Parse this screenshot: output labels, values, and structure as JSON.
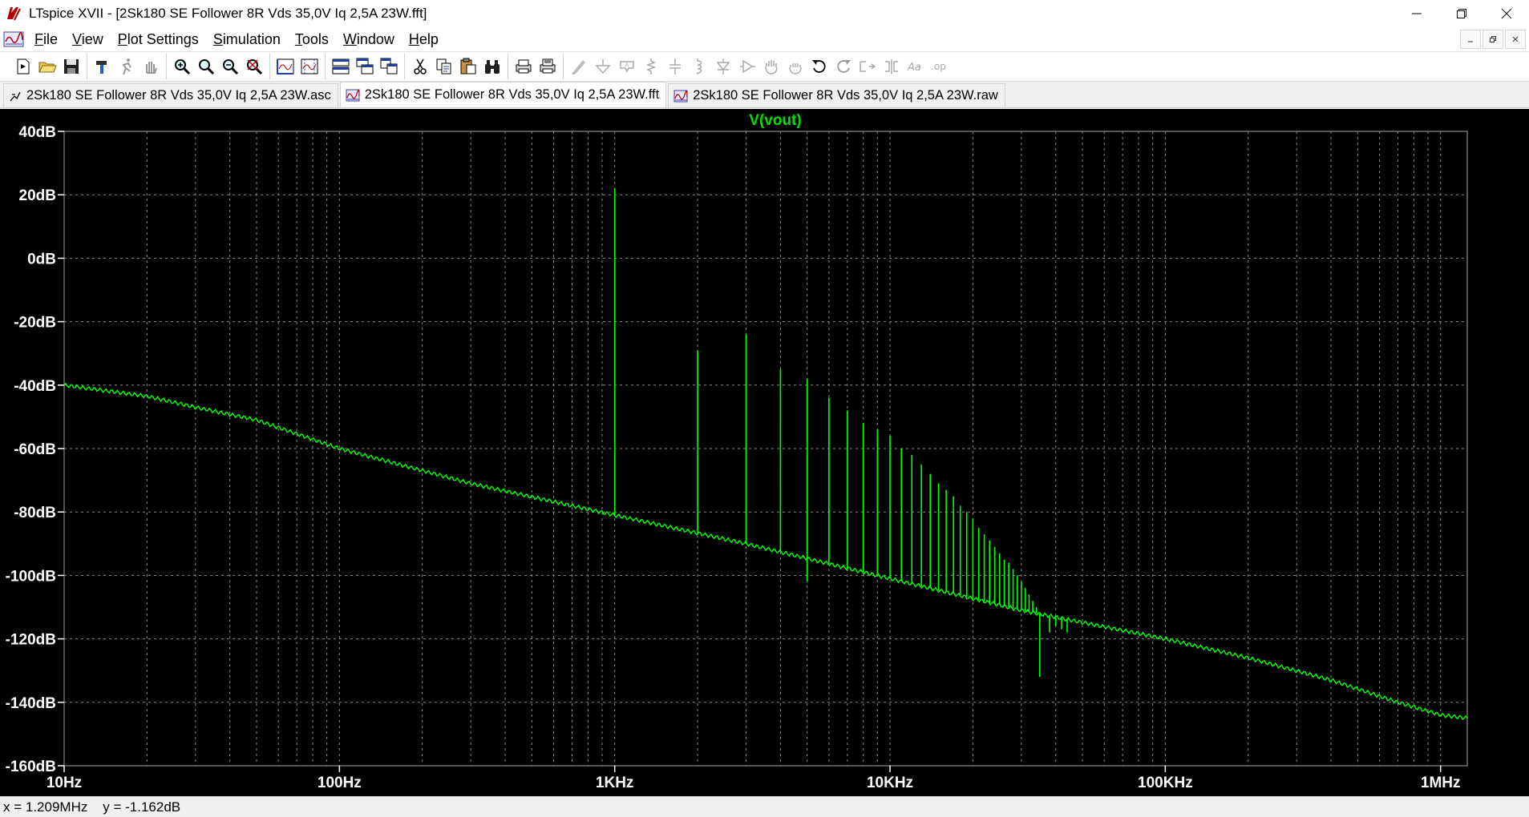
{
  "window": {
    "title": "LTspice XVII - [2Sk180 SE Follower 8R Vds 35,0V Iq 2,5A 23W.fft]"
  },
  "menu": {
    "items": [
      {
        "id": "file",
        "underline": "F",
        "rest": "ile"
      },
      {
        "id": "view",
        "underline": "V",
        "rest": "iew"
      },
      {
        "id": "plot-settings",
        "underline": "P",
        "rest": "lot Settings"
      },
      {
        "id": "simulation",
        "underline": "S",
        "rest": "imulation"
      },
      {
        "id": "tools",
        "underline": "T",
        "rest": "ools"
      },
      {
        "id": "window",
        "underline": "W",
        "rest": "indow"
      },
      {
        "id": "help",
        "underline": "H",
        "rest": "elp"
      }
    ]
  },
  "tabs": [
    {
      "label": "2Sk180 SE Follower 8R Vds 35,0V Iq 2,5A 23W.asc",
      "icon": "schematic-icon",
      "active": false
    },
    {
      "label": "2Sk180 SE Follower 8R Vds 35,0V Iq 2,5A 23W.fft",
      "icon": "waveform-icon",
      "active": true
    },
    {
      "label": "2Sk180 SE Follower 8R Vds 35,0V Iq 2,5A 23W.raw",
      "icon": "waveform-icon",
      "active": false
    }
  ],
  "status": {
    "x_readout": "x = 1.209MHz",
    "y_readout": "y = -1.162dB"
  },
  "colors": {
    "trace": "#00ff00",
    "title": "#00e000",
    "grid": "#8a8a8a",
    "background": "#000000",
    "axis_text": "#ffffff"
  },
  "chart_data": {
    "type": "line",
    "title": "V(vout)",
    "x_scale": "log",
    "x_range": [
      10,
      1250000
    ],
    "y_range": [
      -160,
      40
    ],
    "x_ticks": [
      {
        "value": 10,
        "label": "10Hz"
      },
      {
        "value": 100,
        "label": "100Hz"
      },
      {
        "value": 1000,
        "label": "1KHz"
      },
      {
        "value": 10000,
        "label": "10KHz"
      },
      {
        "value": 100000,
        "label": "100KHz"
      },
      {
        "value": 1000000,
        "label": "1MHz"
      }
    ],
    "y_ticks": [
      {
        "value": 40,
        "label": "40dB"
      },
      {
        "value": 20,
        "label": "20dB"
      },
      {
        "value": 0,
        "label": "0dB"
      },
      {
        "value": -20,
        "label": "-20dB"
      },
      {
        "value": -40,
        "label": "-40dB"
      },
      {
        "value": -60,
        "label": "-60dB"
      },
      {
        "value": -80,
        "label": "-80dB"
      },
      {
        "value": -100,
        "label": "-100dB"
      },
      {
        "value": -120,
        "label": "-120dB"
      },
      {
        "value": -140,
        "label": "-140dB"
      },
      {
        "value": -160,
        "label": "-160dB"
      }
    ],
    "grid": true,
    "series": [
      {
        "name": "V(vout)",
        "noise_floor": [
          [
            10,
            -40
          ],
          [
            20,
            -43.5
          ],
          [
            30,
            -47
          ],
          [
            50,
            -51
          ],
          [
            100,
            -60
          ],
          [
            300,
            -71
          ],
          [
            1000,
            -81
          ],
          [
            3000,
            -90
          ],
          [
            10000,
            -101
          ],
          [
            30000,
            -111
          ],
          [
            100000,
            -120
          ],
          [
            200000,
            -126
          ],
          [
            400000,
            -133
          ],
          [
            700000,
            -140
          ],
          [
            1000000,
            -144
          ],
          [
            1250000,
            -145
          ]
        ],
        "harmonics": [
          {
            "f": 1000,
            "db": 22
          },
          {
            "f": 2000,
            "db": -29
          },
          {
            "f": 3000,
            "db": -24
          },
          {
            "f": 4000,
            "db": -35
          },
          {
            "f": 5000,
            "db": -38
          },
          {
            "f": 6000,
            "db": -44
          },
          {
            "f": 7000,
            "db": -48
          },
          {
            "f": 8000,
            "db": -52
          },
          {
            "f": 9000,
            "db": -54
          },
          {
            "f": 10000,
            "db": -56
          },
          {
            "f": 11000,
            "db": -60
          },
          {
            "f": 12000,
            "db": -62
          },
          {
            "f": 13000,
            "db": -65
          },
          {
            "f": 14000,
            "db": -68
          },
          {
            "f": 15000,
            "db": -71
          },
          {
            "f": 16000,
            "db": -73
          },
          {
            "f": 17000,
            "db": -75
          },
          {
            "f": 18000,
            "db": -78
          },
          {
            "f": 19000,
            "db": -80
          },
          {
            "f": 20000,
            "db": -82
          },
          {
            "f": 21000,
            "db": -85
          },
          {
            "f": 22000,
            "db": -87
          },
          {
            "f": 23000,
            "db": -89
          },
          {
            "f": 24000,
            "db": -91
          },
          {
            "f": 25000,
            "db": -93
          },
          {
            "f": 26000,
            "db": -95
          },
          {
            "f": 27000,
            "db": -96
          },
          {
            "f": 28000,
            "db": -98
          },
          {
            "f": 29000,
            "db": -100
          },
          {
            "f": 30000,
            "db": -102
          },
          {
            "f": 31000,
            "db": -104
          },
          {
            "f": 32000,
            "db": -106
          },
          {
            "f": 33000,
            "db": -108
          },
          {
            "f": 34000,
            "db": -110
          },
          {
            "f": 35000,
            "db": -112
          },
          {
            "f": 36000,
            "db": -113
          },
          {
            "f": 38000,
            "db": -115
          },
          {
            "f": 40000,
            "db": -116
          },
          {
            "f": 42000,
            "db": -117
          },
          {
            "f": 44000,
            "db": -118
          }
        ],
        "dips": [
          {
            "f": 1000,
            "db": -81
          },
          {
            "f": 5000,
            "db": -102
          },
          {
            "f": 35000,
            "db": -132
          },
          {
            "f": 38000,
            "db": -118
          }
        ]
      }
    ]
  }
}
